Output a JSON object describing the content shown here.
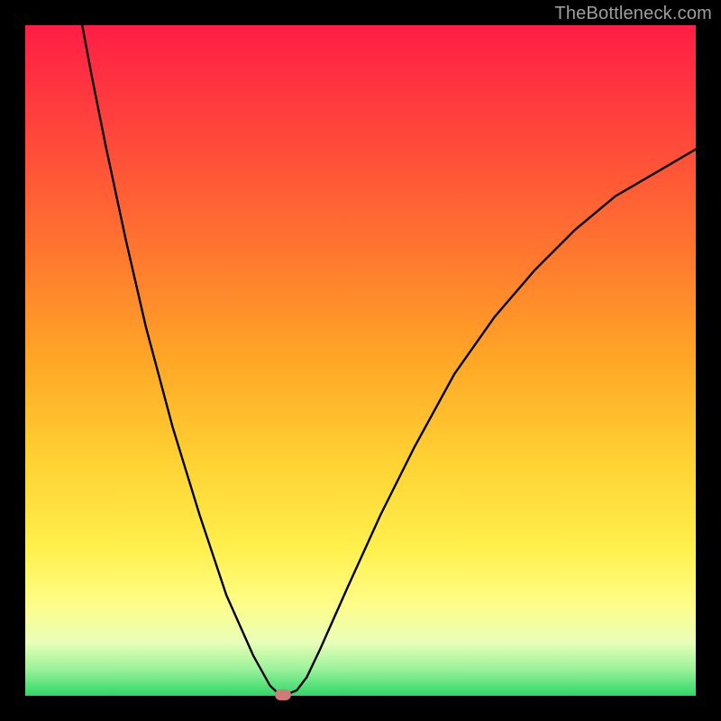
{
  "watermark": "TheBottleneck.com",
  "chart_data": {
    "type": "line",
    "title": "",
    "xlabel": "",
    "ylabel": "",
    "xlim": [
      0,
      1
    ],
    "ylim": [
      0,
      1
    ],
    "grid": false,
    "legend": false,
    "gradient_axis": "vertical",
    "gradient_meaning": "top=high bottleneck (red), bottom=low bottleneck (green)",
    "series": [
      {
        "name": "bottleneck-curve",
        "color": "#000000",
        "x": [
          0.085,
          0.1,
          0.12,
          0.15,
          0.18,
          0.22,
          0.26,
          0.3,
          0.34,
          0.365,
          0.378,
          0.387,
          0.405,
          0.42,
          0.44,
          0.48,
          0.53,
          0.58,
          0.64,
          0.7,
          0.76,
          0.82,
          0.88,
          0.94,
          1.0
        ],
        "y": [
          1.0,
          0.92,
          0.82,
          0.68,
          0.55,
          0.4,
          0.27,
          0.15,
          0.06,
          0.015,
          0.003,
          0.001,
          0.008,
          0.028,
          0.07,
          0.16,
          0.27,
          0.37,
          0.48,
          0.565,
          0.635,
          0.695,
          0.745,
          0.78,
          0.815
        ]
      }
    ],
    "marker": {
      "x": 0.385,
      "y": 0.002,
      "color": "#d17a7a"
    }
  }
}
